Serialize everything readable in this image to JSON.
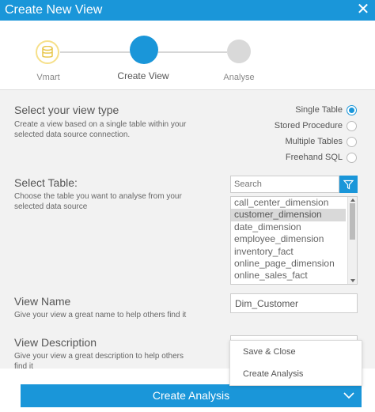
{
  "window": {
    "title": "Create New View"
  },
  "wizard": {
    "steps": [
      {
        "label": "Vmart",
        "state": "done"
      },
      {
        "label": "Create View",
        "state": "active"
      },
      {
        "label": "Analyse",
        "state": "pending"
      }
    ]
  },
  "view_type": {
    "title": "Select your view type",
    "description": "Create a view based on a single table within your selected data source connection.",
    "options": [
      {
        "label": "Single Table",
        "checked": true
      },
      {
        "label": "Stored Procedure",
        "checked": false
      },
      {
        "label": "Multiple Tables",
        "checked": false
      },
      {
        "label": "Freehand SQL",
        "checked": false
      }
    ]
  },
  "select_table": {
    "title": "Select Table:",
    "description": "Choose the table you want to analyse from your selected data source",
    "search_placeholder": "Search",
    "tables": [
      "call_center_dimension",
      "customer_dimension",
      "date_dimension",
      "employee_dimension",
      "inventory_fact",
      "online_page_dimension",
      "online_sales_fact"
    ],
    "selected": "customer_dimension"
  },
  "view_name": {
    "title": "View Name",
    "description": "Give your view a great name to help others find it",
    "value": "Dim_Customer"
  },
  "view_description": {
    "title": "View Description",
    "description": "Give your view a great description to help others find it"
  },
  "menu": {
    "items": [
      "Save & Close",
      "Create Analysis"
    ]
  },
  "footer": {
    "create_label": "Create Analysis"
  },
  "colors": {
    "accent": "#1a96d9",
    "step_done": "#f6e08a",
    "pending": "#d9d9d9"
  },
  "icons": {
    "close": "close-icon",
    "database": "database-icon",
    "filter": "filter-icon",
    "chevron": "chevron-down-icon"
  }
}
